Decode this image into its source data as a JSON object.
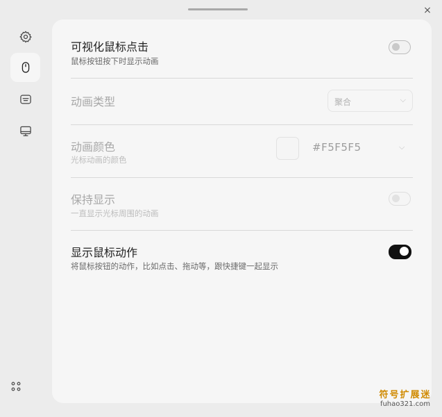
{
  "window": {
    "close_label": "×"
  },
  "sidebar": {
    "items": [
      {
        "name": "settings",
        "icon": "gear-icon"
      },
      {
        "name": "mouse",
        "icon": "mouse-icon",
        "active": true
      },
      {
        "name": "keyboard",
        "icon": "keyboard-icon"
      },
      {
        "name": "display",
        "icon": "monitor-icon"
      }
    ],
    "bottom_icon": "apps-grid-icon"
  },
  "settings": {
    "visualize_click": {
      "title": "可视化鼠标点击",
      "desc": "鼠标按钮按下时显示动画",
      "enabled": false
    },
    "animation_type": {
      "title": "动画类型",
      "value": "聚合",
      "disabled": true
    },
    "animation_color": {
      "title": "动画颜色",
      "desc": "光标动画的颜色",
      "value": "#F5F5F5",
      "disabled": true
    },
    "keep_showing": {
      "title": "保持显示",
      "desc": "一直显示光标周围的动画",
      "enabled": false,
      "disabled": true
    },
    "show_mouse_actions": {
      "title": "显示鼠标动作",
      "desc": "将鼠标按钮的动作，比如点击、拖动等，跟快捷键一起显示",
      "enabled": true
    }
  },
  "watermark": {
    "title": "符号扩展迷",
    "url": "fuhao321.com"
  },
  "colors": {
    "accent": "#111111",
    "panel": "#f6f6f6",
    "background": "#ececec"
  }
}
